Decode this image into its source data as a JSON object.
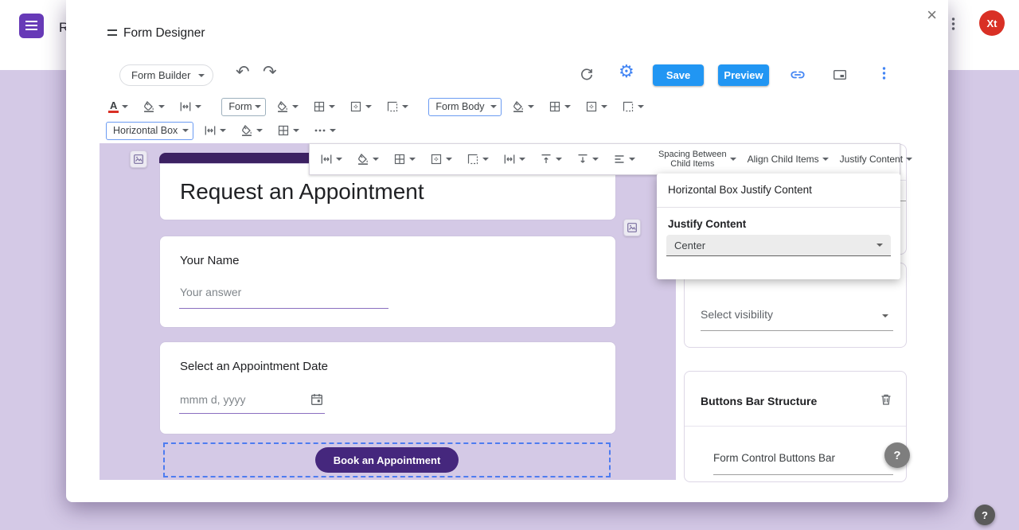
{
  "colors": {
    "lavender": "#d4c9e6",
    "purple": "#673ab7",
    "form-header": "#3c2162",
    "btn-purple": "#45277d",
    "blue": "#2196f3",
    "icon-blue": "#4285f4",
    "icon-grey": "#5f6368",
    "text": "#202124",
    "muted": "#80868b",
    "border": "#dadce0",
    "card-border": "#cec4e0",
    "dashed-blue": "#4e7cf0",
    "avatar-red": "#d93025",
    "underline-purple": "#8a6fc0"
  },
  "background": {
    "doc_title_partial": "R",
    "avatar_initials": "Xt"
  },
  "dialog": {
    "title": "Form Designer",
    "close_glyph": "×"
  },
  "toolbar": {
    "form_builder_label": "Form Builder",
    "save_label": "Save",
    "preview_label": "Preview",
    "form_select": "Form",
    "form_body_select": "Form Body",
    "horizontal_box_select": "Horizontal Box"
  },
  "floating_toolbar": {
    "spacing_between_line1": "Spacing Between",
    "spacing_between_line2": "Child Items",
    "align_child_items_label": "Align Child Items",
    "justify_content_label": "Justify Content"
  },
  "justify_panel": {
    "header": "Horizontal Box Justify Content",
    "field_label": "Justify Content",
    "selected_value": "Center"
  },
  "form_preview": {
    "title": "Request an Appointment",
    "name_field": {
      "label": "Your Name",
      "placeholder": "Your answer"
    },
    "date_field": {
      "label": "Select an Appointment Date",
      "placeholder": "mmm d, yyyy"
    },
    "submit_button_label": "Book an Appointment"
  },
  "sidebar": {
    "visibility_select_placeholder": "Select visibility",
    "buttons_bar": {
      "title": "Buttons Bar Structure",
      "item_label": "Form Control Buttons Bar"
    },
    "help_glyph": "?"
  },
  "page_help_glyph": "?",
  "icons": {
    "gear": "⚙",
    "undo": "↶",
    "redo": "↷",
    "text-color-letter": "A"
  }
}
